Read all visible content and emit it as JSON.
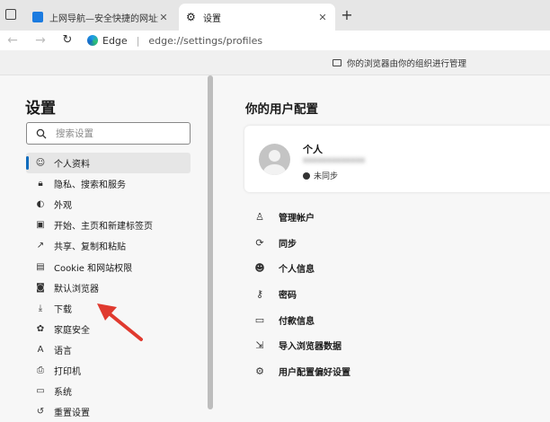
{
  "tabs": [
    {
      "title": "上网导航—安全快捷的网址大全",
      "icon": "blue-shield-icon",
      "active": false
    },
    {
      "title": "设置",
      "icon": "gear-icon",
      "active": true
    }
  ],
  "address_bar": {
    "brand": "Edge",
    "url": "edge://settings/profiles"
  },
  "notice": "你的浏览器由你的组织进行管理",
  "sidebar": {
    "title": "设置",
    "search_placeholder": "搜索设置",
    "items": [
      {
        "label": "个人资料",
        "icon": "profile-icon",
        "selected": true
      },
      {
        "label": "隐私、搜索和服务",
        "icon": "lock-icon"
      },
      {
        "label": "外观",
        "icon": "appearance-icon"
      },
      {
        "label": "开始、主页和新建标签页",
        "icon": "home-tab-icon"
      },
      {
        "label": "共享、复制和粘贴",
        "icon": "share-icon"
      },
      {
        "label": "Cookie 和网站权限",
        "icon": "cookie-icon"
      },
      {
        "label": "默认浏览器",
        "icon": "default-browser-icon"
      },
      {
        "label": "下载",
        "icon": "download-icon"
      },
      {
        "label": "家庭安全",
        "icon": "family-icon"
      },
      {
        "label": "语言",
        "icon": "language-icon"
      },
      {
        "label": "打印机",
        "icon": "printer-icon"
      },
      {
        "label": "系统",
        "icon": "system-icon"
      },
      {
        "label": "重置设置",
        "icon": "reset-icon"
      }
    ]
  },
  "main": {
    "title": "你的用户配置",
    "profile": {
      "name": "个人",
      "email": "xxxxxxxxxxxxx",
      "sync_status": "未同步"
    },
    "options": [
      {
        "label": "管理帐户",
        "icon": "account-icon"
      },
      {
        "label": "同步",
        "icon": "sync-icon"
      },
      {
        "label": "个人信息",
        "icon": "personal-info-icon"
      },
      {
        "label": "密码",
        "icon": "key-icon"
      },
      {
        "label": "付款信息",
        "icon": "card-icon"
      },
      {
        "label": "导入浏览器数据",
        "icon": "import-icon"
      },
      {
        "label": "用户配置偏好设置",
        "icon": "profile-prefs-icon"
      }
    ]
  },
  "colors": {
    "accent": "#0f6cbd",
    "annotation_arrow": "#e03a2f"
  }
}
